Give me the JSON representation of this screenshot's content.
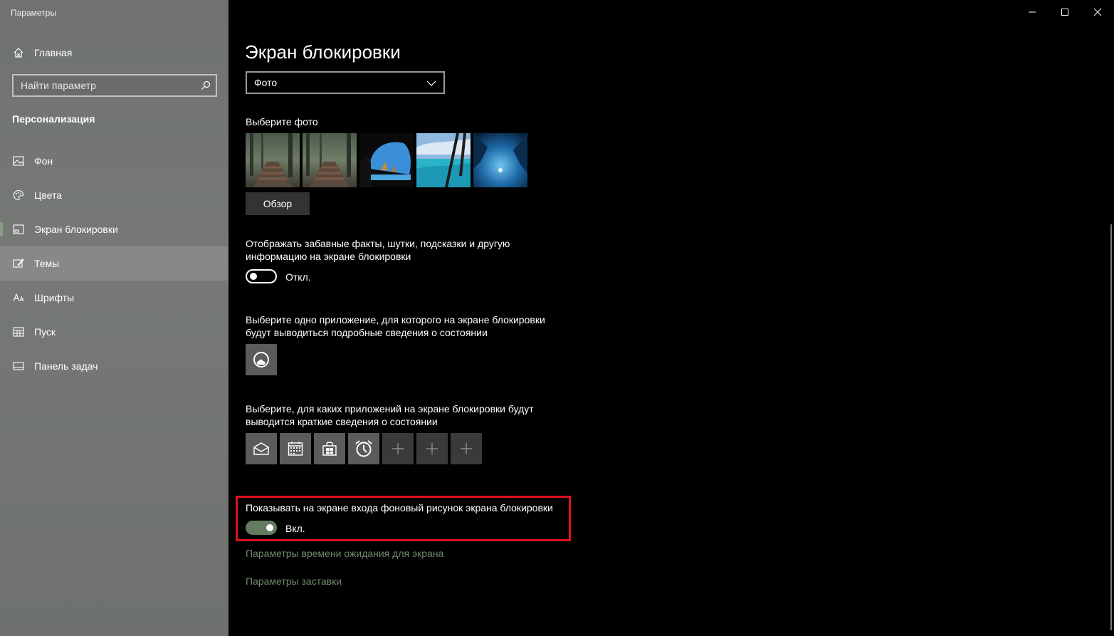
{
  "window": {
    "title": "Параметры",
    "controls": [
      "minimize",
      "maximize",
      "close"
    ]
  },
  "sidebar": {
    "home_label": "Главная",
    "search_placeholder": "Найти параметр",
    "section_heading": "Персонализация",
    "items": [
      {
        "label": "Фон",
        "icon": "image-icon"
      },
      {
        "label": "Цвета",
        "icon": "palette-icon"
      },
      {
        "label": "Экран блокировки",
        "icon": "lock-screen-icon",
        "selected": true
      },
      {
        "label": "Темы",
        "icon": "themes-icon",
        "hover": true
      },
      {
        "label": "Шрифты",
        "icon": "fonts-icon"
      },
      {
        "label": "Пуск",
        "icon": "start-icon"
      },
      {
        "label": "Панель задач",
        "icon": "taskbar-icon"
      }
    ]
  },
  "main": {
    "page_title": "Экран блокировки",
    "background_dropdown": {
      "selected": "Фото"
    },
    "choose_photo_label": "Выберите фото",
    "browse_label": "Обзор",
    "fun_facts": {
      "line1": "Отображать забавные факты, шутки, подсказки и другую",
      "line2": "информацию на экране блокировки",
      "state": "Откл."
    },
    "detailed_status": {
      "line1": "Выберите одно приложение, для которого на экране блокировки",
      "line2": "будут выводиться подробные сведения о состоянии"
    },
    "quick_status": {
      "line1": "Выберите, для каких приложений на экране блокировки будут",
      "line2": "выводится краткие сведения о состоянии",
      "apps": [
        "mail-icon",
        "calendar-icon",
        "store-icon",
        "alarm-icon",
        "plus-icon",
        "plus-icon",
        "plus-icon"
      ]
    },
    "signin_background": {
      "label": "Показывать на экране входа фоновый рисунок экрана блокировки",
      "state": "Вкл."
    },
    "links": {
      "timeout": "Параметры времени ожидания для экрана",
      "screensaver": "Параметры заставки"
    }
  },
  "colors": {
    "accent": "#647b62",
    "link": "#6e8a6c",
    "highlight": "#e0101e"
  }
}
